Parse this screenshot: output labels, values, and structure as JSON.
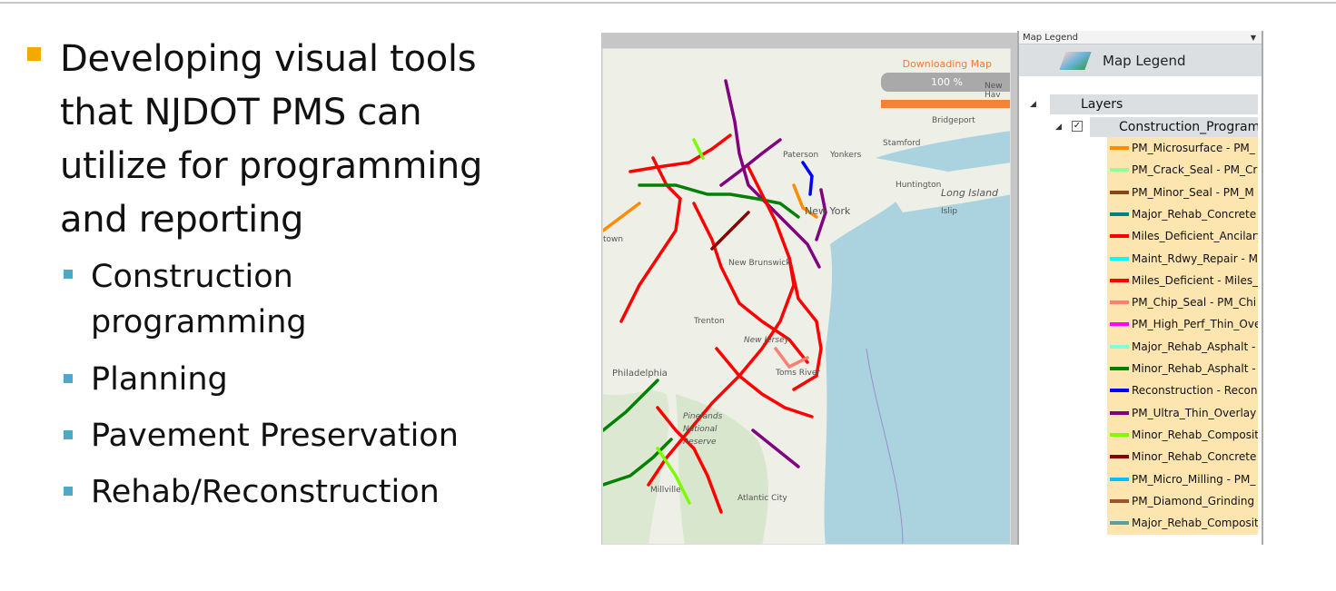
{
  "slide": {
    "heading": "Developing visual tools that NJDOT PMS can utilize for programming and reporting",
    "bullets": [
      "Construction programming",
      "Planning",
      "Pavement Preservation",
      "Rehab/Reconstruction"
    ],
    "accent": "#f2a900",
    "sub_bullet_color": "#4fa8c8"
  },
  "map": {
    "download_label": "Downloading Map",
    "progress_text": "100 %",
    "progress": 100,
    "place_labels": [
      "New Hav",
      "Bridgeport",
      "Stamford",
      "Huntington",
      "Long Island",
      "Islip",
      "Yonkers",
      "Paterson",
      "New York",
      "New Brunswick",
      "Trenton",
      "New Jersey",
      "Toms River",
      "Philadelphia",
      "Pinelands National Reserve",
      "Millville",
      "Atlantic City",
      "town"
    ]
  },
  "legend": {
    "panel_title": "Map Legend",
    "header": "Map Legend",
    "icon": "map-layers-icon",
    "root": "Layers",
    "group": "Construction_Program",
    "items": [
      {
        "label": "PM_Microsurface - PM_",
        "color": "#ff8c00"
      },
      {
        "label": "PM_Crack_Seal - PM_Cr",
        "color": "#98fb98"
      },
      {
        "label": "PM_Minor_Seal - PM_M",
        "color": "#8b4513"
      },
      {
        "label": "Major_Rehab_Concrete",
        "color": "#008080"
      },
      {
        "label": "Miles_Deficient_Ancilary",
        "color": "#ff0000"
      },
      {
        "label": "Maint_Rdwy_Repair - M",
        "color": "#00ffff"
      },
      {
        "label": "Miles_Deficient - Miles_",
        "color": "#ff0000"
      },
      {
        "label": "PM_Chip_Seal - PM_Chi",
        "color": "#fa8072"
      },
      {
        "label": "PM_High_Perf_Thin_Ove",
        "color": "#ff00ff"
      },
      {
        "label": "Major_Rehab_Asphalt -",
        "color": "#7fffd4"
      },
      {
        "label": "Minor_Rehab_Asphalt -",
        "color": "#008000"
      },
      {
        "label": "Reconstruction - Recons",
        "color": "#0000ff"
      },
      {
        "label": "PM_Ultra_Thin_Overlay",
        "color": "#800080"
      },
      {
        "label": "Minor_Rehab_Composit",
        "color": "#7cfc00"
      },
      {
        "label": "Minor_Rehab_Concrete",
        "color": "#8b0000"
      },
      {
        "label": "PM_Micro_Milling - PM_",
        "color": "#00bfff"
      },
      {
        "label": "PM_Diamond_Grinding",
        "color": "#a0522d"
      },
      {
        "label": "Major_Rehab_Composit",
        "color": "#5f9ea0"
      }
    ]
  }
}
